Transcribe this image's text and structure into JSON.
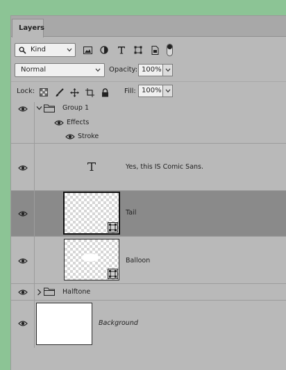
{
  "panel": {
    "tab_label": "Layers"
  },
  "filter_row": {
    "kind_label": "Kind",
    "icons": [
      "pixel-filter-icon",
      "adjustment-filter-icon",
      "type-filter-icon",
      "shape-filter-icon",
      "smart-object-filter-icon",
      "filter-toggle-icon"
    ]
  },
  "blend_row": {
    "mode_label": "Normal",
    "opacity_label": "Opacity:",
    "opacity_value": "100%"
  },
  "lock_row": {
    "lock_label": "Lock:",
    "fill_label": "Fill:",
    "fill_value": "100%",
    "icons": [
      "lock-transparent-pixels-icon",
      "lock-image-pixels-icon",
      "lock-position-icon",
      "lock-artboard-icon",
      "lock-all-icon"
    ]
  },
  "layers": [
    {
      "name": "Group 1",
      "type": "group",
      "expanded": true,
      "effects_label": "Effects",
      "stroke_label": "Stroke"
    },
    {
      "name": "Yes, this IS Comic Sans.",
      "type": "text"
    },
    {
      "name": "Tail",
      "type": "smart-object",
      "selected": true
    },
    {
      "name": "Balloon",
      "type": "smart-object"
    },
    {
      "name": "Halftone",
      "type": "group",
      "expanded": false
    },
    {
      "name": "Background",
      "type": "background"
    }
  ],
  "colors": {
    "page_background": "#8cc495",
    "panel_background": "#b9b9b9",
    "selected_row": "#8a8a8a"
  }
}
